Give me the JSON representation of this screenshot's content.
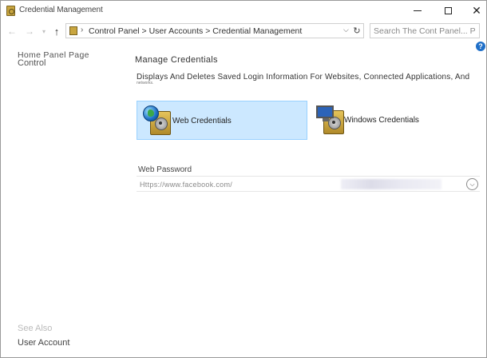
{
  "window": {
    "title": "Credential Management"
  },
  "nav": {
    "breadcrumb": "Control Panel > User Accounts > Credential Management",
    "search_placeholder": "Search The Cont Panel... P"
  },
  "left_pane": {
    "home_line1": "Home Panel Page",
    "home_line2": "Control",
    "see_also": "See Also",
    "user_account": "User Account"
  },
  "main": {
    "title": "Manage Credentials",
    "description": "Displays And Deletes Saved Login Information For Websites, Connected Applications, And",
    "description_cont": "networks.",
    "tiles": [
      {
        "label": "Web Credentials",
        "icon": "web-vault-icon",
        "selected": true
      },
      {
        "label": "Windows Credentials",
        "icon": "windows-vault-icon",
        "selected": false
      }
    ],
    "web_password": {
      "label": "Web Password",
      "url": "Https://www.facebook.com/"
    }
  },
  "colors": {
    "selected_tile_bg": "#cce8ff",
    "selected_tile_border": "#99d1ff",
    "help_blue": "#1f6fc8"
  }
}
